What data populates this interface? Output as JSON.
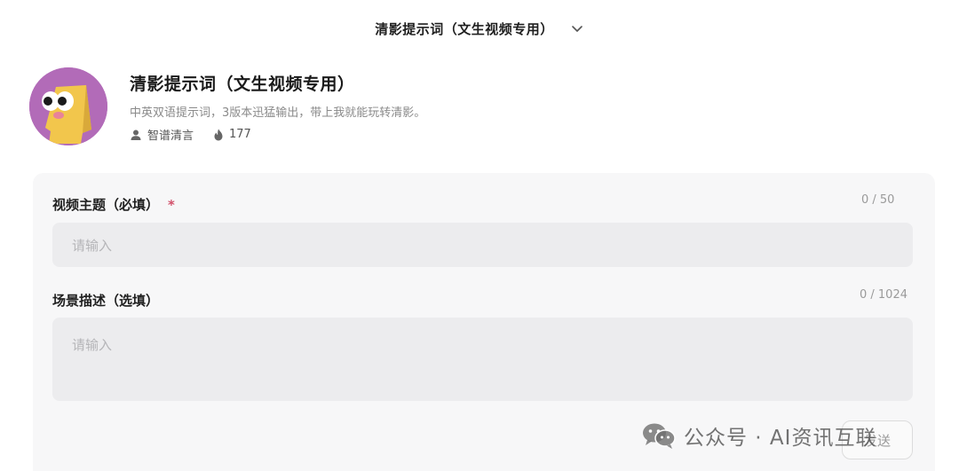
{
  "topbar": {
    "title": "清影提示词（文生视频专用）",
    "dropdown_icon": "chevron-down-icon"
  },
  "app": {
    "name": "清影提示词（文生视频专用）",
    "description": "中英双语提示词，3版本迅猛输出，带上我就能玩转清影。",
    "author": "智谱清言",
    "usage_count": "177",
    "avatar_colors": {
      "background": "#b26bb8",
      "face": "#f2c64c"
    }
  },
  "form": {
    "fields": [
      {
        "label": "视频主题（必填）",
        "required_mark": "*",
        "counter": "0 / 50",
        "placeholder": "请输入"
      },
      {
        "label": "场景描述（选填）",
        "counter": "0 / 1024",
        "placeholder": "请输入"
      }
    ],
    "submit_label": "发送"
  },
  "watermark": {
    "text": "公众号 · AI资讯互联"
  }
}
